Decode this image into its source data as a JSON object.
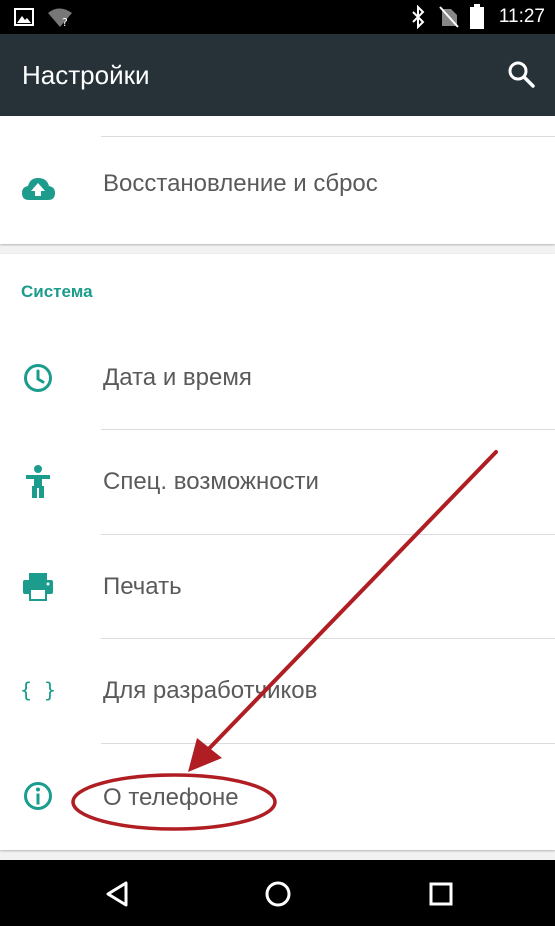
{
  "status_bar": {
    "time": "11:27",
    "icons": [
      "image-icon",
      "wifi-unknown-icon",
      "bluetooth-icon",
      "no-sim-icon",
      "battery-icon"
    ]
  },
  "app_bar": {
    "title": "Настройки",
    "search_icon": "search-icon"
  },
  "top_items": [
    {
      "label": "Восстановление и сброс",
      "icon": "cloud-upload-icon"
    }
  ],
  "system_section": {
    "header": "Система",
    "items": [
      {
        "label": "Дата и время",
        "icon": "clock-icon"
      },
      {
        "label": "Спец. возможности",
        "icon": "accessibility-icon"
      },
      {
        "label": "Печать",
        "icon": "printer-icon"
      },
      {
        "label": "Для разработчиков",
        "icon": "code-braces-icon"
      },
      {
        "label": "О телефоне",
        "icon": "info-icon"
      }
    ]
  },
  "nav_bar": {
    "icons": [
      "back-icon",
      "home-icon",
      "recents-icon"
    ]
  },
  "annotation": {
    "color": "#b01e23",
    "type": "arrow-and-ellipse",
    "target": "О телефоне"
  },
  "colors": {
    "status_bar": "#000000",
    "app_bar": "#263238",
    "accent": "#1c9c8c",
    "label_text": "#5a5a5a",
    "background": "#f2f2f2",
    "annotation": "#b01e23"
  }
}
